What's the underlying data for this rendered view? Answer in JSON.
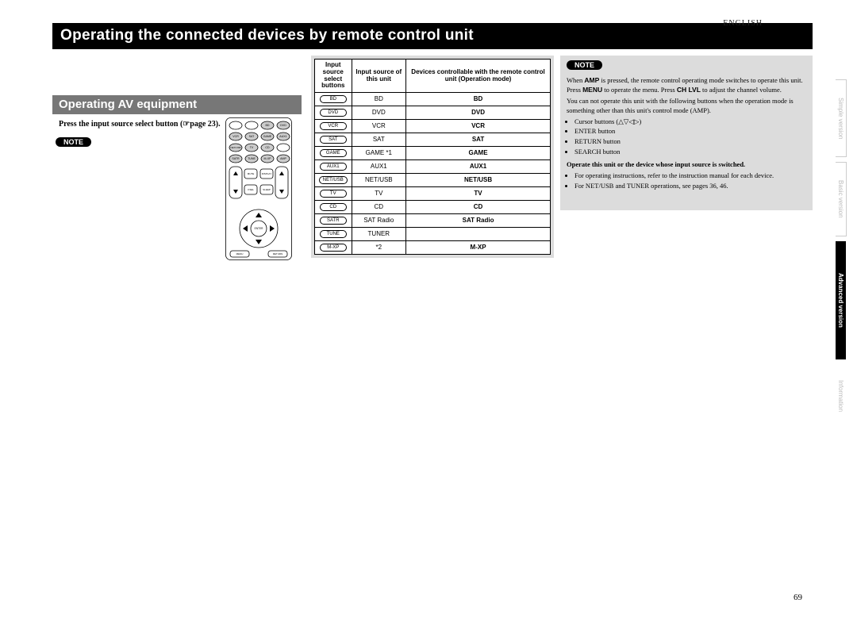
{
  "language_label": "ENGLISH",
  "main_title": "Operating the connected devices by remote control unit",
  "section_heading": "Operating AV equipment",
  "instruction": "Press the input source select button (☞page 23).",
  "page_number": "69",
  "remote": {
    "row1": [
      "",
      "",
      "BD",
      "DVD"
    ],
    "row2": [
      "VCR",
      "SAT",
      "GAME",
      "AUX1"
    ],
    "row3": [
      "NET/USB",
      "TV",
      "CD",
      ""
    ],
    "row4": [
      "SATR",
      "TUNE",
      "M-XP",
      "AMP"
    ],
    "center": "ENTER"
  },
  "table": {
    "header": {
      "col1": "Input source select buttons",
      "col2": "Input source of this unit",
      "col3": "Devices controllable with the remote control unit (Operation mode)"
    },
    "rows": [
      {
        "btn": "BD",
        "src": "BD",
        "mode": "BD"
      },
      {
        "btn": "DVD",
        "src": "DVD",
        "mode": "DVD"
      },
      {
        "btn": "VCR",
        "src": "VCR",
        "mode": "VCR"
      },
      {
        "btn": "SAT",
        "src": "SAT",
        "mode": "SAT"
      },
      {
        "btn": "GAME",
        "src": "GAME *1",
        "mode": "GAME"
      },
      {
        "btn": "AUX1",
        "src": "AUX1",
        "mode": "AUX1"
      },
      {
        "btn": "NET/USB",
        "src": "NET/USB",
        "mode": "NET/USB"
      },
      {
        "btn": "TV",
        "src": "TV",
        "mode": "TV"
      },
      {
        "btn": "CD",
        "src": "CD",
        "mode": "CD"
      },
      {
        "btn": "SATR",
        "src": "SAT Radio",
        "mode": "SAT Radio"
      },
      {
        "btn": "TUNE",
        "src": "TUNER",
        "mode": ""
      },
      {
        "btn": "M-XP",
        "src": "*2",
        "mode": "M-XP"
      }
    ]
  },
  "notes": {
    "amp": "AMP",
    "menu": "MENU",
    "chlvl": "CH LVL",
    "callout": "Operate this unit or the device whose input source is switched.",
    "body_parts": [
      "When ",
      " is pressed, the remote control operating mode switches to operate this unit. Press ",
      " to operate the menu. Press ",
      " to adjust the channel volume.",
      "You can not operate this unit with the following buttons when the operation mode is something other than this unit's control mode (AMP)."
    ],
    "bullets": [
      "Cursor buttons (△▽◁▷)",
      "ENTER button",
      "RETURN button",
      "SEARCH button"
    ],
    "footer_bullets": [
      "For operating instructions, refer to the instruction manual for each device.",
      "For NET/USB and TUNER operations, see pages 36, 46."
    ]
  },
  "tabs": {
    "simple": "Simple version",
    "basic": "Basic version",
    "advanced": "Advanced version",
    "information": "Information"
  }
}
